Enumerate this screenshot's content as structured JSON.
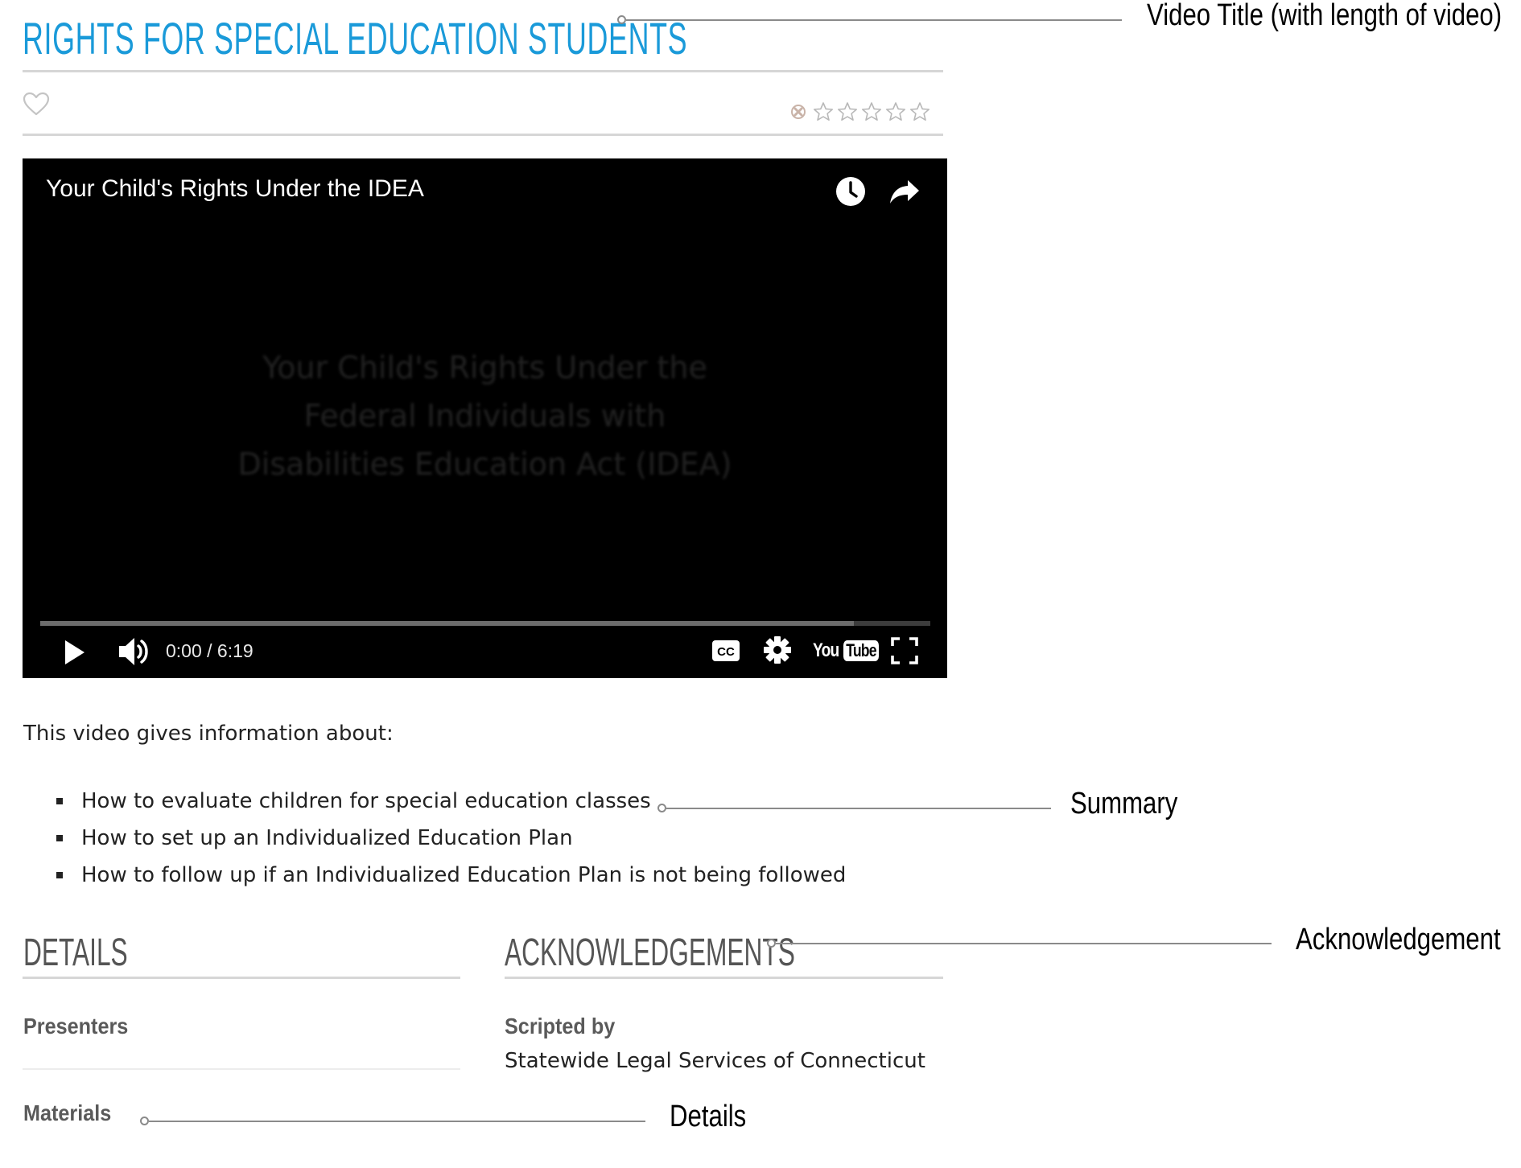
{
  "page": {
    "title": "RIGHTS FOR SPECIAL EDUCATION STUDENTS"
  },
  "icons": {
    "favorite": "heart-outline-icon",
    "rating_cancel": "cancel-rating-icon",
    "rating_star": "star-outline-icon"
  },
  "rating": {
    "value": 0,
    "max": 5
  },
  "video": {
    "title": "Your Child's Rights Under the IDEA",
    "slide_lines": [
      "Your Child's Rights Under the",
      "Federal Individuals with",
      "Disabilities Education Act (IDEA)"
    ],
    "time_display": "0:00 / 6:19",
    "played_fraction": 0.0,
    "loaded_fraction": 0.914,
    "logo_you": "You",
    "logo_tube": "Tube",
    "icons": {
      "watch_later": "clock-icon",
      "share": "share-arrow-icon",
      "play": "play-icon",
      "volume": "volume-icon",
      "captions": "cc-icon",
      "settings": "gear-icon",
      "fullscreen": "fullscreen-icon"
    }
  },
  "summary": {
    "intro": "This video gives information about:",
    "items": [
      "How to evaluate children for special education classes",
      "How to set up an Individualized Education Plan",
      "How to follow up if an Individualized Education Plan is not being followed"
    ]
  },
  "details": {
    "heading": "DETAILS",
    "presenters_label": "Presenters",
    "materials_label": "Materials"
  },
  "acknowledgements": {
    "heading": "ACKNOWLEDGEMENTS",
    "scripted_by_label": "Scripted by",
    "scripted_by_value": "Statewide Legal Services of Connecticut"
  },
  "annotations": {
    "video_title": "Video Title (with length of video)",
    "summary": "Summary",
    "acknowledgement": "Acknowledgement",
    "details": "Details"
  },
  "colors": {
    "title_blue": "#1a9ad9",
    "heading_gray": "#555555",
    "player_bg": "#000000",
    "annotation_line": "#8a8a8a"
  }
}
